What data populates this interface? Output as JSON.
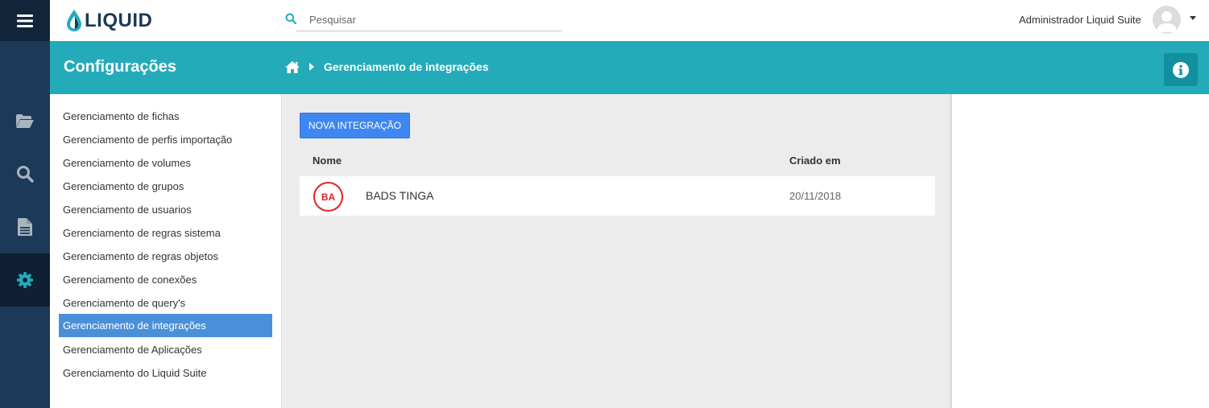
{
  "app": {
    "logo_text": "LIQUID"
  },
  "search": {
    "placeholder": "Pesquisar"
  },
  "user": {
    "name": "Administrador Liquid Suite"
  },
  "header": {
    "title": "Configurações",
    "breadcrumb_current": "Gerenciamento de integrações"
  },
  "rail": {
    "items": [
      "folder-open-icon",
      "search-icon",
      "document-icon",
      "gear-icon"
    ],
    "active_index": 3
  },
  "sidebar": {
    "items": [
      {
        "label": "Gerenciamento de fichas"
      },
      {
        "label": "Gerenciamento de perfis importação"
      },
      {
        "label": "Gerenciamento de volumes"
      },
      {
        "label": "Gerenciamento de grupos"
      },
      {
        "label": "Gerenciamento de usuarios"
      },
      {
        "label": "Gerenciamento de regras sistema"
      },
      {
        "label": "Gerenciamento de regras objetos"
      },
      {
        "label": "Gerenciamento de conexões"
      },
      {
        "label": "Gerenciamento de query's"
      },
      {
        "label": "Gerenciamento de integrações"
      },
      {
        "label": "Gerenciamento de Aplicações"
      },
      {
        "label": "Gerenciamento do Liquid Suite"
      }
    ],
    "active_index": 9
  },
  "main": {
    "new_button_label": "NOVA INTEGRAÇÃO",
    "columns": {
      "name": "Nome",
      "created": "Criado em"
    },
    "rows": [
      {
        "badge": "BA",
        "name": "BADS TINGA",
        "created": "20/11/2018"
      }
    ]
  },
  "colors": {
    "rail": "#1c3957",
    "header_teal": "#24abba",
    "primary_button": "#3f87f0",
    "sidebar_active": "#4a90d9",
    "badge_red": "#e02424"
  }
}
